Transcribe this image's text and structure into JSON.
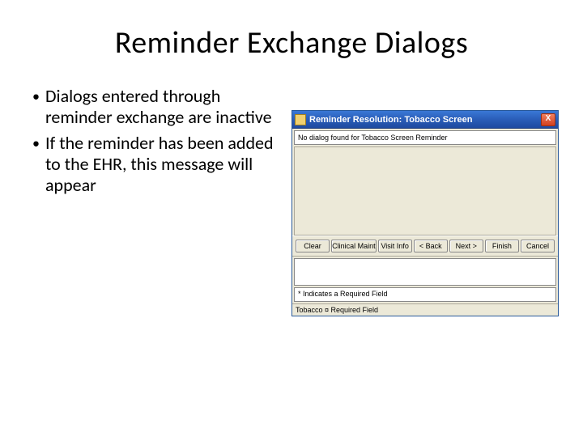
{
  "slide": {
    "title": "Reminder Exchange Dialogs",
    "bullets": [
      "Dialogs entered through reminder exchange are inactive",
      "If the reminder has been added to the EHR, this message will appear"
    ]
  },
  "window": {
    "title": "Reminder Resolution: Tobacco Screen",
    "close_label": "X",
    "message": "No dialog found for Tobacco Screen Reminder",
    "buttons": {
      "clear": "Clear",
      "clinical_maint": "Clinical Maint",
      "visit_info": "Visit Info",
      "back": "< Back",
      "next": "Next >",
      "finish": "Finish",
      "cancel": "Cancel"
    },
    "note_label": "* Indicates a Required Field",
    "status": "Tobacco ¤ Required Field"
  }
}
